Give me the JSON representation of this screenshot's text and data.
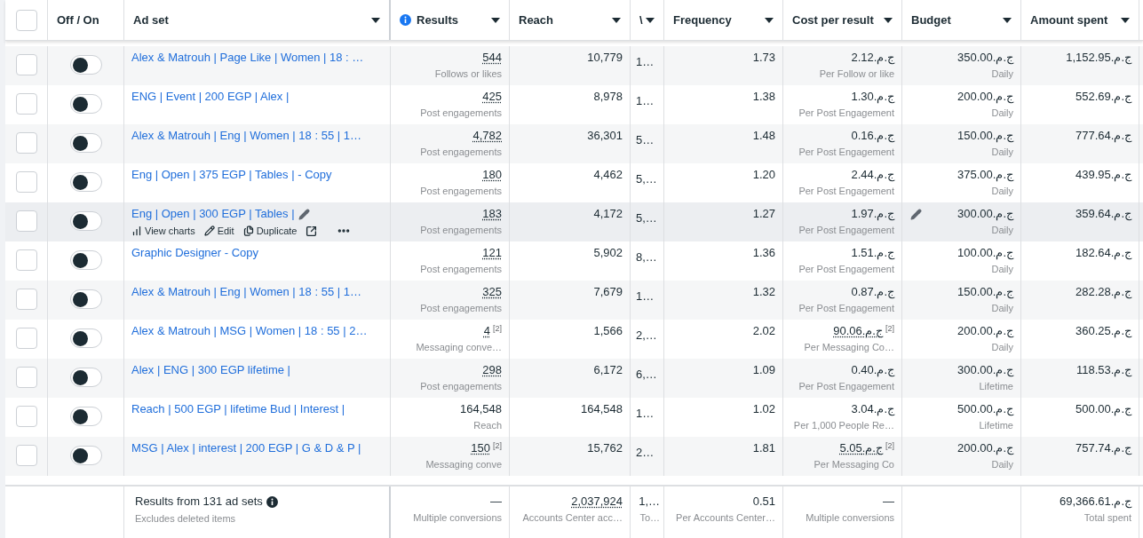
{
  "header": {
    "checked": false,
    "columns": [
      {
        "label": "Off / On",
        "sortable": false,
        "info": false
      },
      {
        "label": "Ad set",
        "sortable": true,
        "info": false
      },
      {
        "label": "Results",
        "sortable": true,
        "info": true
      },
      {
        "label": "Reach",
        "sortable": true,
        "info": false
      },
      {
        "label": "\\",
        "sortable": true,
        "info": false
      },
      {
        "label": "Frequency",
        "sortable": true,
        "info": false
      },
      {
        "label": "Cost per result",
        "sortable": true,
        "info": false
      },
      {
        "label": "Budget",
        "sortable": true,
        "info": false
      },
      {
        "label": "Amount spent",
        "sortable": true,
        "info": false
      }
    ]
  },
  "rows": [
    {
      "checked": false,
      "on": false,
      "hovered": false,
      "name": "Alex & Matrouh | Page Like | Women | 18 : …",
      "results": {
        "value": "544",
        "label": "Follows or likes",
        "dotted": true
      },
      "reach": "10,779",
      "column_5": "1…",
      "frequency": "1.73",
      "cost": {
        "value": "ج.م.2.12",
        "label": "Per Follow or like",
        "dotted": false
      },
      "budget": {
        "value": "ج.م.350.00",
        "label": "Daily"
      },
      "amount": "ج.م.1,152.95"
    },
    {
      "checked": false,
      "on": false,
      "hovered": false,
      "name": "ENG | Event | 200 EGP | Alex |",
      "results": {
        "value": "425",
        "label": "Post engagements",
        "dotted": true
      },
      "reach": "8,978",
      "column_5": "1…",
      "frequency": "1.38",
      "cost": {
        "value": "ج.م.1.30",
        "label": "Per Post Engagement",
        "dotted": false
      },
      "budget": {
        "value": "ج.م.200.00",
        "label": "Daily"
      },
      "amount": "ج.م.552.69"
    },
    {
      "checked": false,
      "on": false,
      "hovered": false,
      "name": "Alex & Matrouh | Eng | Women | 18 : 55 | 1…",
      "results": {
        "value": "4,782",
        "label": "Post engagements",
        "dotted": true
      },
      "reach": "36,301",
      "column_5": "5…",
      "frequency": "1.48",
      "cost": {
        "value": "ج.م.0.16",
        "label": "Per Post Engagement",
        "dotted": false
      },
      "budget": {
        "value": "ج.م.150.00",
        "label": "Daily"
      },
      "amount": "ج.م.777.64"
    },
    {
      "checked": false,
      "on": false,
      "hovered": false,
      "name": "Eng | Open | 375 EGP | Tables | - Copy",
      "results": {
        "value": "180",
        "label": "Post engagements",
        "dotted": true
      },
      "reach": "4,462",
      "column_5": "5,…",
      "frequency": "1.20",
      "cost": {
        "value": "ج.م.2.44",
        "label": "Per Post Engagement",
        "dotted": false
      },
      "budget": {
        "value": "ج.م.375.00",
        "label": "Daily"
      },
      "amount": "ج.م.439.95"
    },
    {
      "checked": false,
      "on": false,
      "hovered": true,
      "name": "Eng | Open | 300 EGP | Tables |",
      "actions": [
        "View charts",
        "Edit",
        "Duplicate"
      ],
      "results": {
        "value": "183",
        "label": "Post engagements",
        "dotted": true
      },
      "reach": "4,172",
      "column_5": "5,…",
      "frequency": "1.27",
      "cost": {
        "value": "ج.م.1.97",
        "label": "Per Post Engagement",
        "dotted": false
      },
      "budget": {
        "value": "ج.م.300.00",
        "label": "Daily"
      },
      "amount": "ج.م.359.64"
    },
    {
      "checked": false,
      "on": false,
      "hovered": false,
      "name": "Graphic Designer - Copy",
      "results": {
        "value": "121",
        "label": "Post engagements",
        "dotted": true
      },
      "reach": "5,902",
      "column_5": "8,…",
      "frequency": "1.36",
      "cost": {
        "value": "ج.م.1.51",
        "label": "Per Post Engagement",
        "dotted": false
      },
      "budget": {
        "value": "ج.م.100.00",
        "label": "Daily"
      },
      "amount": "ج.م.182.64"
    },
    {
      "checked": false,
      "on": false,
      "hovered": false,
      "name": "Alex & Matrouh | Eng | Women | 18 : 55 | 1…",
      "results": {
        "value": "325",
        "label": "Post engagements",
        "dotted": true
      },
      "reach": "7,679",
      "column_5": "1…",
      "frequency": "1.32",
      "cost": {
        "value": "ج.م.0.87",
        "label": "Per Post Engagement",
        "dotted": false
      },
      "budget": {
        "value": "ج.م.150.00",
        "label": "Daily"
      },
      "amount": "ج.م.282.28"
    },
    {
      "checked": false,
      "on": false,
      "hovered": false,
      "name": "Alex & Matrouh | MSG | Women | 18 : 55 | 2…",
      "results": {
        "value": "4",
        "note": "[2]",
        "label": "Messaging conve…",
        "dotted": true
      },
      "reach": "1,566",
      "column_5": "2,…",
      "frequency": "2.02",
      "cost": {
        "value": "ج.م.90.06",
        "note": "[2]",
        "label": "Per Messaging Co…",
        "dotted": true
      },
      "budget": {
        "value": "ج.م.200.00",
        "label": "Daily"
      },
      "amount": "ج.م.360.25"
    },
    {
      "checked": false,
      "on": false,
      "hovered": false,
      "name": "Alex | ENG | 300 EGP lifetime |",
      "results": {
        "value": "298",
        "label": "Post engagements",
        "dotted": true
      },
      "reach": "6,172",
      "column_5": "6,…",
      "frequency": "1.09",
      "cost": {
        "value": "ج.م.0.40",
        "label": "Per Post Engagement",
        "dotted": false
      },
      "budget": {
        "value": "ج.م.300.00",
        "label": "Lifetime"
      },
      "amount": "ج.م.118.53"
    },
    {
      "checked": false,
      "on": false,
      "hovered": false,
      "name": "Reach | 500 EGP | lifetime Bud | Interest |",
      "results": {
        "value": "164,548",
        "label": "Reach",
        "dotted": false
      },
      "reach": "164,548",
      "column_5": "1…",
      "frequency": "1.02",
      "cost": {
        "value": "ج.م.3.04",
        "label": "Per 1,000 People Re…",
        "dotted": false
      },
      "budget": {
        "value": "ج.م.500.00",
        "label": "Lifetime"
      },
      "amount": "ج.م.500.00"
    },
    {
      "checked": false,
      "on": false,
      "hovered": false,
      "name": "MSG | Alex | interest | 200 EGP | G & D & P |",
      "results": {
        "value": "150",
        "note": "[2]",
        "label": "Messaging conve",
        "dotted": true
      },
      "reach": "15,762",
      "column_5": "2…",
      "frequency": "1.81",
      "cost": {
        "value": "ج.م.5.05",
        "note": "[2]",
        "label": "Per Messaging Co",
        "dotted": true
      },
      "budget": {
        "value": "ج.م.200.00",
        "label": "Daily"
      },
      "amount": "ج.م.757.74"
    }
  ],
  "footer": {
    "title": "Results from 131 ad sets",
    "subtitle": "Excludes deleted items",
    "cells": [
      {
        "value": "—",
        "label": "Multiple conversions",
        "dotted": false
      },
      {
        "value": "2,037,924",
        "label": "Accounts Center acc…",
        "dotted": true
      },
      {
        "value": "1,…",
        "label": "To…",
        "dotted": false
      },
      {
        "value": "0.51",
        "label": "Per Accounts Center…",
        "dotted": false
      },
      {
        "value": "—",
        "label": "Multiple conversions",
        "dotted": false
      },
      null,
      {
        "value": "ج.م.69,366.61",
        "label": "Total spent",
        "dotted": false
      }
    ]
  }
}
